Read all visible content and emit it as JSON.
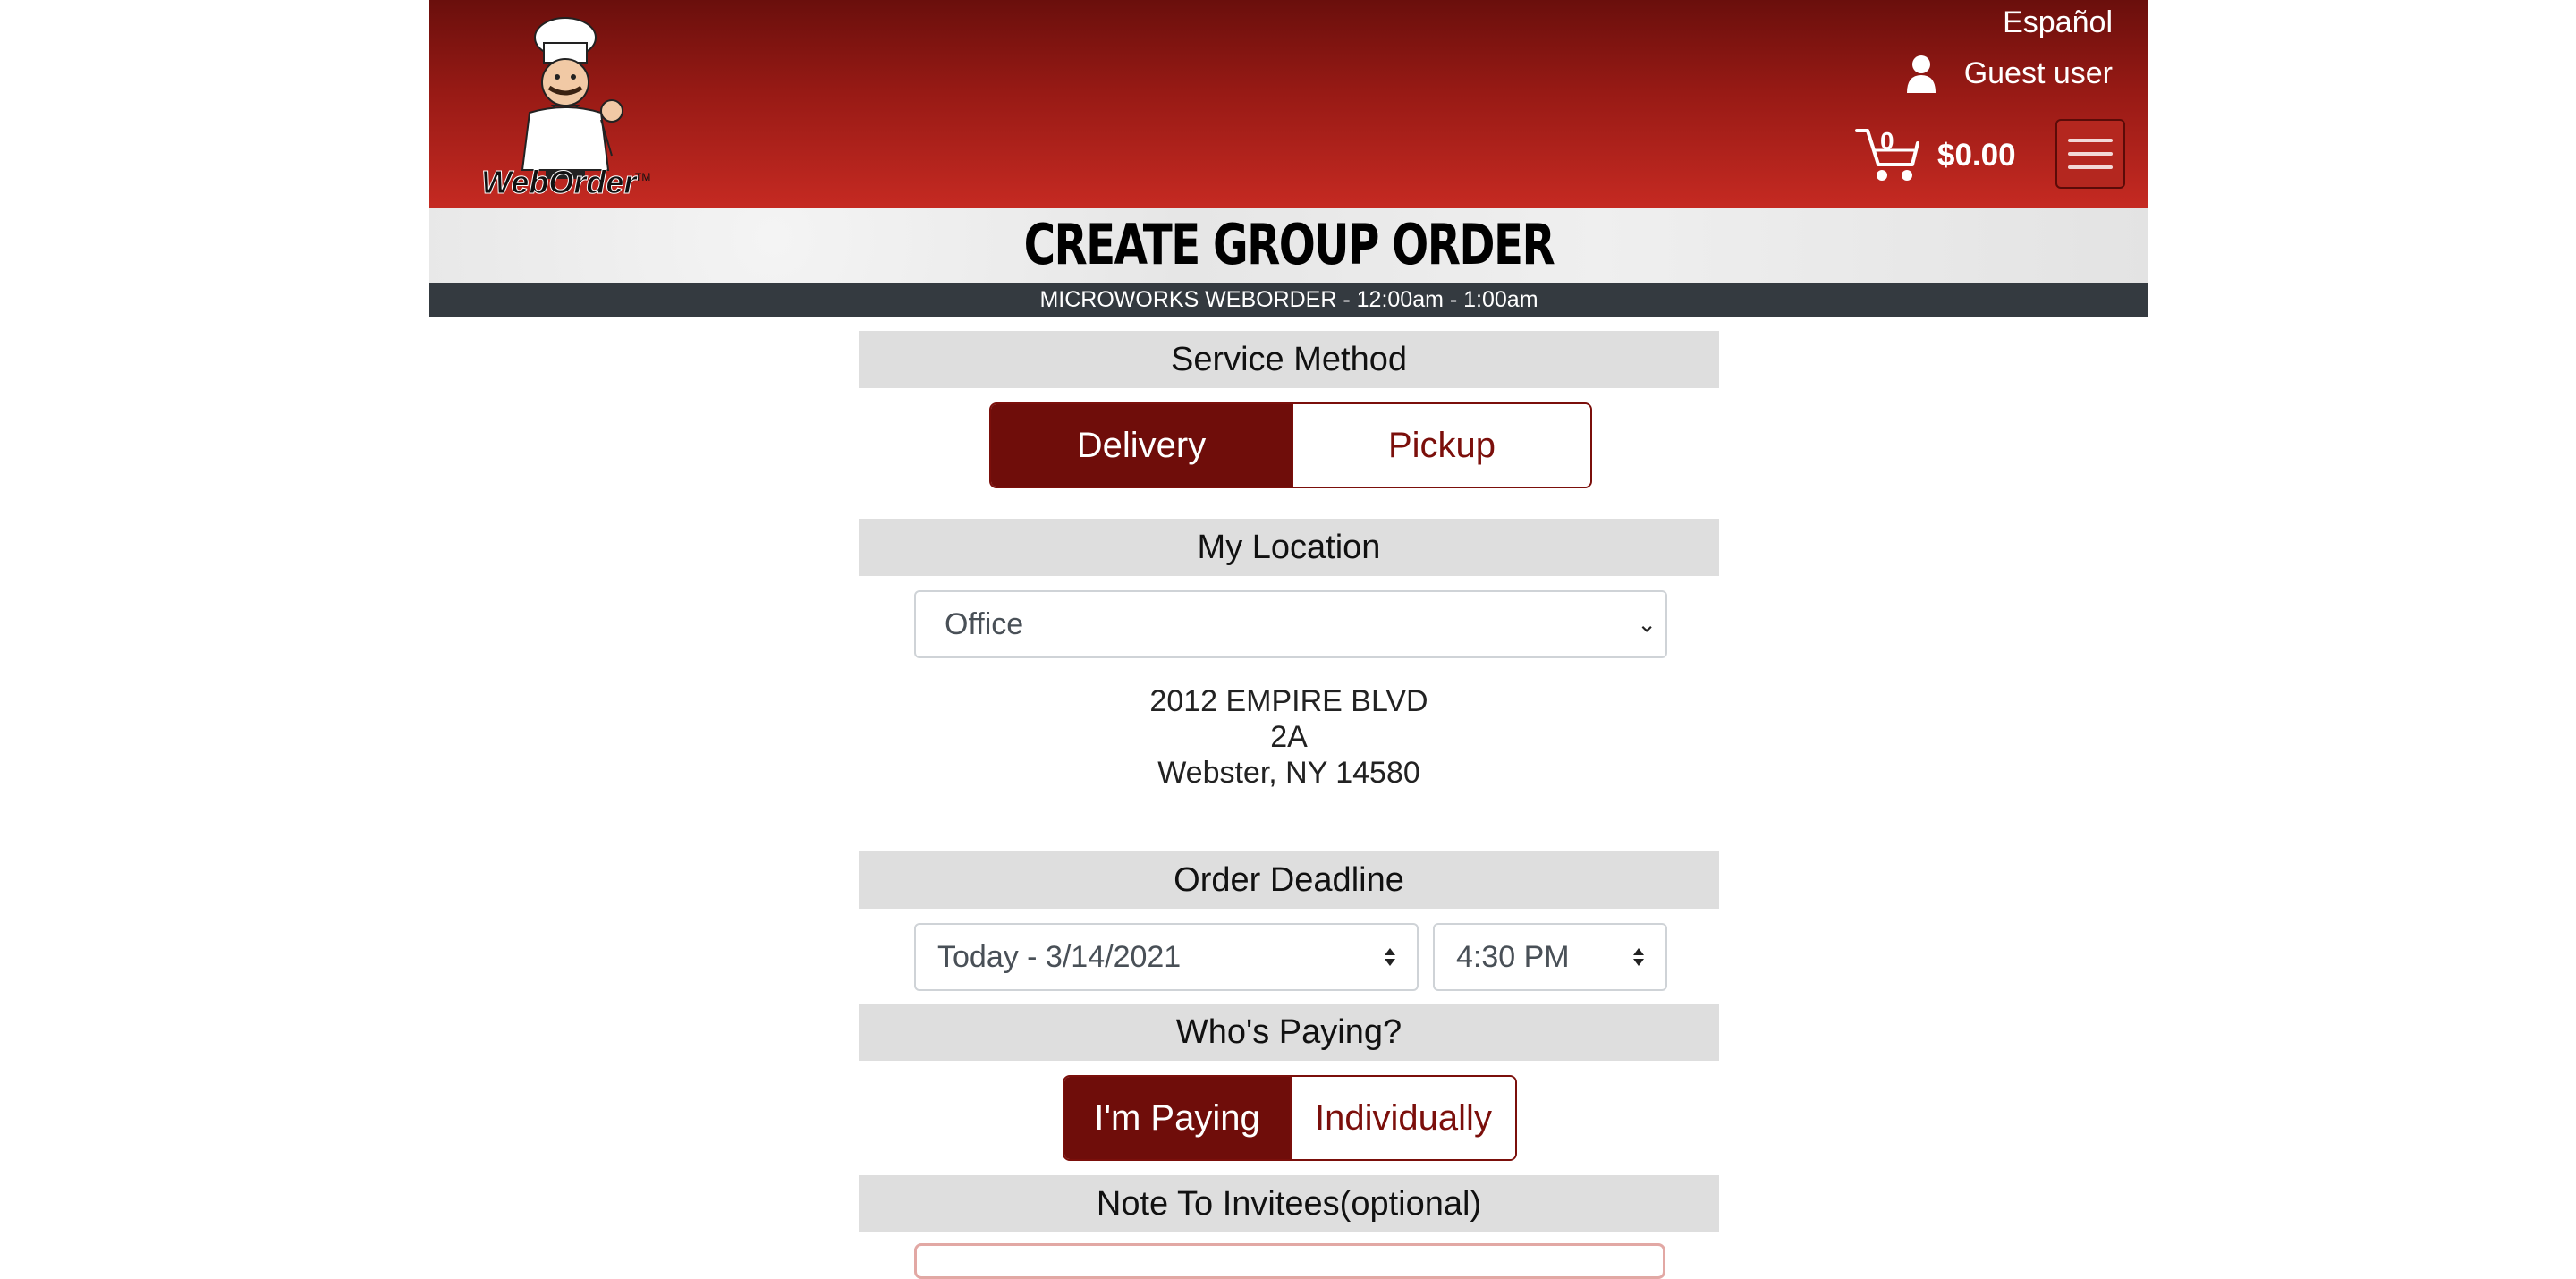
{
  "header": {
    "logo_text": "WebOrder",
    "language_link": "Español",
    "user_label": "Guest user",
    "cart_count": "0",
    "cart_total": "$0.00",
    "colors": {
      "header_dark": "#6a0f0c",
      "header_light": "#c52a22",
      "accent": "#6f0d0a"
    }
  },
  "page": {
    "title": "CREATE GROUP ORDER",
    "hours": "MICROWORKS WEBORDER - 12:00am - 1:00am"
  },
  "service_method": {
    "heading": "Service Method",
    "options": [
      "Delivery",
      "Pickup"
    ],
    "selected": "Delivery"
  },
  "location": {
    "heading": "My Location",
    "selected": "Office",
    "address_line1": "2012 EMPIRE BLVD",
    "address_line2": "2A",
    "address_line3": "Webster, NY 14580"
  },
  "deadline": {
    "heading": "Order Deadline",
    "date": "Today - 3/14/2021",
    "time": "4:30 PM"
  },
  "payment": {
    "heading": "Who's Paying?",
    "options": [
      "I'm Paying",
      "Individually"
    ],
    "selected": "I'm Paying"
  },
  "note": {
    "heading": "Note To Invitees(optional)"
  }
}
